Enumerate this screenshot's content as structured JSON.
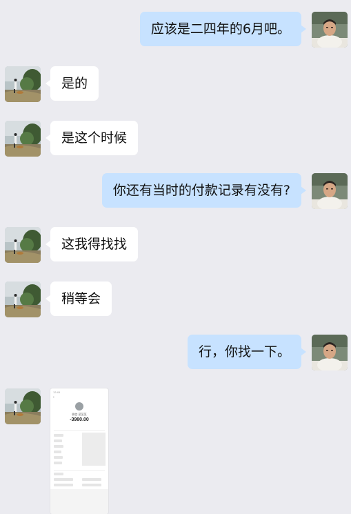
{
  "messages": [
    {
      "side": "out",
      "text": "应该是二四年的6月吧。"
    },
    {
      "side": "in",
      "text": "是的"
    },
    {
      "side": "in",
      "text": "是这个时候"
    },
    {
      "side": "out",
      "text": "你还有当时的付款记录有没有?"
    },
    {
      "side": "in",
      "text": "这我得找找"
    },
    {
      "side": "in",
      "text": "稍等会"
    },
    {
      "side": "out",
      "text": "行，你找一下。"
    },
    {
      "side": "in",
      "type": "image"
    }
  ],
  "screenshot": {
    "status_time": "12:45",
    "merchant": "微信·某某某",
    "amount": "-3980.00"
  },
  "colors": {
    "chat_background": "#ebebf0",
    "outgoing_bubble": "#c7e2ff",
    "incoming_bubble": "#ffffff"
  }
}
